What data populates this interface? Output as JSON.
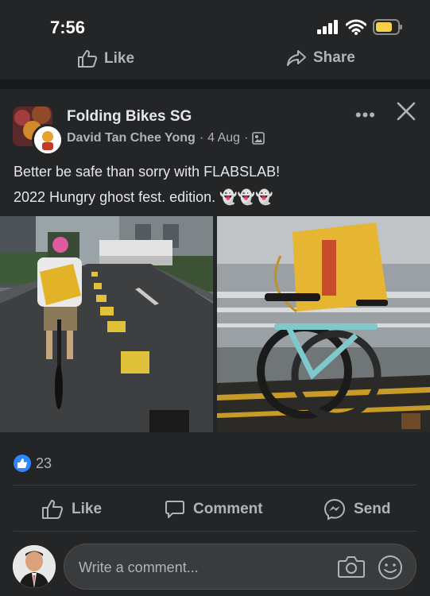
{
  "status": {
    "time": "7:56"
  },
  "top_actions": {
    "like": "Like",
    "share": "Share"
  },
  "post": {
    "group_name": "Folding Bikes SG",
    "author": "David Tan Chee Yong",
    "date": "4 Aug",
    "separator": "·",
    "more": "•••",
    "text_line1": "Better be safe than sorry with FLABSLAB!",
    "text_line2": "2022 Hungry ghost fest. edition. 👻👻👻",
    "reaction_count": "23"
  },
  "actions": {
    "like": "Like",
    "comment": "Comment",
    "send": "Send"
  },
  "comment": {
    "placeholder": "Write a comment..."
  },
  "colors": {
    "background": "#242526",
    "band": "#18191a",
    "accent": "#2d88ff",
    "text": "#e4e6eb",
    "muted": "#b0b3b8"
  }
}
